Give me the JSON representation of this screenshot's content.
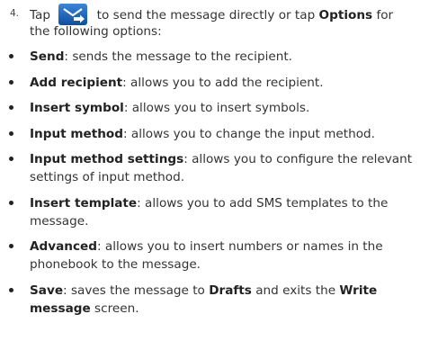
{
  "step": {
    "number": "4.",
    "text_tap": "Tap",
    "text_after_icon": "to send the message directly or tap",
    "options_label": "Options",
    "text_for": "for",
    "line2": "the following options:",
    "icon": "send-message-icon",
    "icon_color": "#1a5fb4"
  },
  "bullets": [
    {
      "term": "Send",
      "desc": ": sends the message to the recipient.",
      "desc2": ""
    },
    {
      "term": "Add recipient",
      "desc": ": allows you to add the recipient.",
      "desc2": ""
    },
    {
      "term": "Insert symbol",
      "desc": ": allows you to insert symbols.",
      "desc2": ""
    },
    {
      "term": "Input method",
      "desc": ": allows you to change the input method.",
      "desc2": ""
    },
    {
      "term": "Input method settings",
      "desc": ": allows you to configure the relevant",
      "desc2": "settings of input method."
    },
    {
      "term": "Insert template",
      "desc": ": allows you to add SMS templates to the",
      "desc2": "message."
    },
    {
      "term": "Advanced",
      "desc": ": allows you to insert numbers or names in the",
      "desc2": "phonebook to the message."
    }
  ],
  "last_bullet": {
    "term": "Save",
    "desc_a": ": saves the message to",
    "drafts": "Drafts",
    "desc_b": "and exits the",
    "write": "Write",
    "message_bold": "message",
    "desc_c": "screen."
  }
}
